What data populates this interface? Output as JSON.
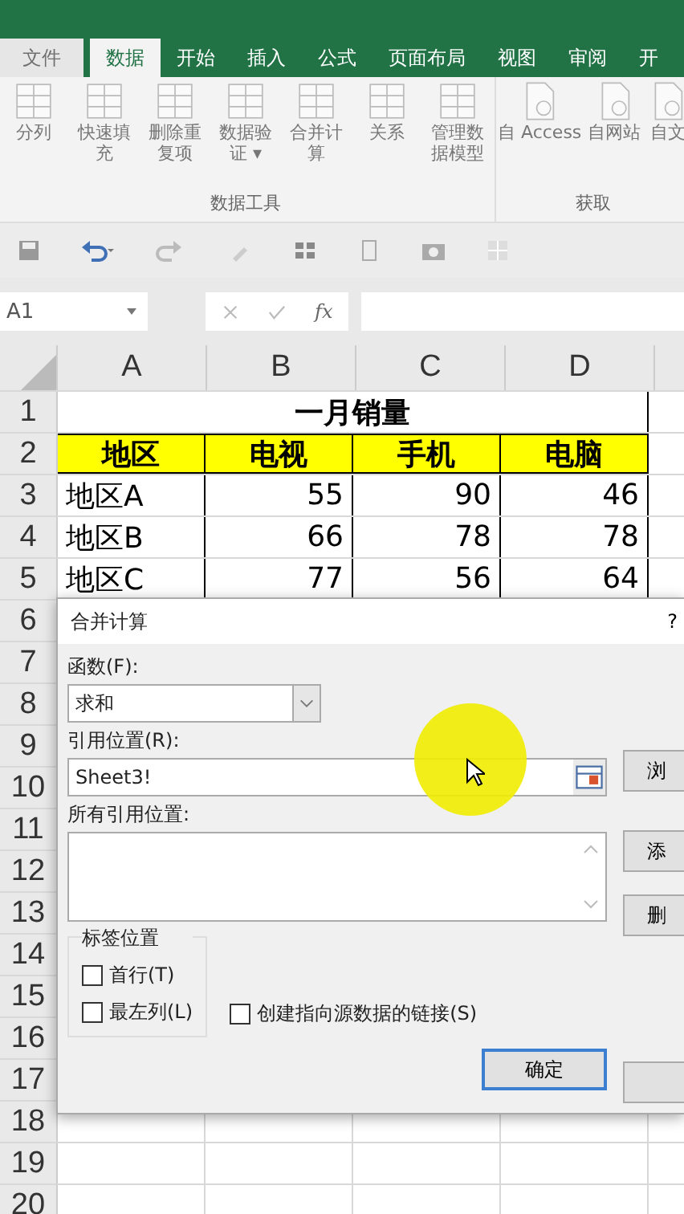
{
  "tabs": [
    {
      "label": "文件",
      "kind": "file",
      "selected": false
    },
    {
      "label": "数据",
      "kind": "tab",
      "selected": true
    },
    {
      "label": "开始",
      "kind": "tab",
      "selected": false
    },
    {
      "label": "插入",
      "kind": "tab",
      "selected": false
    },
    {
      "label": "公式",
      "kind": "tab",
      "selected": false
    },
    {
      "label": "页面布局",
      "kind": "tab",
      "selected": false
    },
    {
      "label": "视图",
      "kind": "tab",
      "selected": false
    },
    {
      "label": "审阅",
      "kind": "tab",
      "selected": false
    },
    {
      "label": "开",
      "kind": "tab",
      "selected": false
    }
  ],
  "ribbon": {
    "groups": [
      {
        "label": "数据工具",
        "kind": "tools",
        "items": [
          {
            "label": "分列"
          },
          {
            "label": "快速填充"
          },
          {
            "label": "删除重复项"
          },
          {
            "label": "数据验证 ▾"
          },
          {
            "label": "合并计算"
          },
          {
            "label": "关系"
          },
          {
            "label": "管理数据模型"
          }
        ]
      },
      {
        "label": "获取",
        "kind": "external",
        "items": [
          {
            "label": "自 Access"
          },
          {
            "label": "自网站"
          },
          {
            "label": "自文"
          }
        ]
      }
    ]
  },
  "formula_bar": {
    "name_box": "A1",
    "fx": "fx"
  },
  "sheet": {
    "columns": [
      "A",
      "B",
      "C",
      "D"
    ],
    "rows": [
      {
        "number": "1",
        "kind": "title",
        "cells": [
          "一月销量"
        ]
      },
      {
        "number": "2",
        "kind": "header",
        "cells": [
          "地区",
          "电视",
          "手机",
          "电脑"
        ]
      },
      {
        "number": "3",
        "kind": "data",
        "cells": [
          "地区A",
          "55",
          "90",
          "46"
        ]
      },
      {
        "number": "4",
        "kind": "data",
        "cells": [
          "地区B",
          "66",
          "78",
          "78"
        ]
      },
      {
        "number": "5",
        "kind": "data",
        "cells": [
          "地区C",
          "77",
          "56",
          "64"
        ]
      },
      {
        "number": "6",
        "kind": "empty"
      },
      {
        "number": "7",
        "kind": "empty"
      },
      {
        "number": "8",
        "kind": "empty"
      },
      {
        "number": "9",
        "kind": "empty"
      },
      {
        "number": "10",
        "kind": "empty"
      },
      {
        "number": "11",
        "kind": "empty"
      },
      {
        "number": "12",
        "kind": "empty"
      },
      {
        "number": "13",
        "kind": "empty"
      },
      {
        "number": "14",
        "kind": "empty"
      },
      {
        "number": "15",
        "kind": "empty"
      },
      {
        "number": "16",
        "kind": "empty"
      },
      {
        "number": "17",
        "kind": "empty"
      },
      {
        "number": "18",
        "kind": "empty"
      },
      {
        "number": "19",
        "kind": "empty"
      },
      {
        "number": "20",
        "kind": "empty"
      }
    ]
  },
  "dialog": {
    "title": "合并计算",
    "help": "?",
    "function_label": "函数(F):",
    "function_value": "求和",
    "reference_label": "引用位置(R):",
    "reference_value": "Sheet3!",
    "all_references_label": "所有引用位置:",
    "label_group": "标签位置",
    "checkboxes": [
      {
        "label": "首行(T)",
        "checked": false
      },
      {
        "label": "最左列(L)",
        "checked": false
      },
      {
        "label": "创建指向源数据的链接(S)",
        "checked": false
      }
    ],
    "side_buttons": [
      "浏",
      "添",
      "删"
    ],
    "ok_button": "确定"
  }
}
